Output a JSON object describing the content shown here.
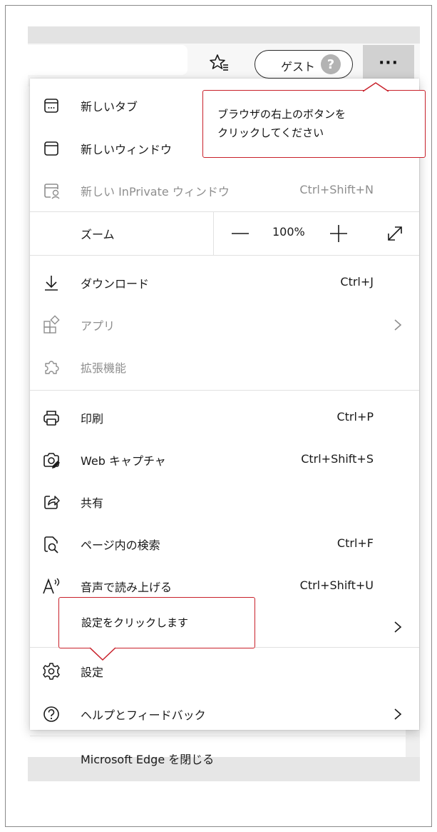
{
  "toolbar": {
    "guest_label": "ゲスト",
    "guest_avatar_glyph": "?",
    "more_label": "···"
  },
  "menu": {
    "new_tab": "新しいタブ",
    "new_window": "新しいウィンドウ",
    "new_inprivate": "新しい InPrivate ウィンドウ",
    "new_inprivate_shortcut": "Ctrl+Shift+N",
    "zoom_label": "ズーム",
    "zoom_value": "100%",
    "downloads": "ダウンロード",
    "downloads_shortcut": "Ctrl+J",
    "apps": "アプリ",
    "extensions": "拡張機能",
    "print": "印刷",
    "print_shortcut": "Ctrl+P",
    "web_capture": "Web キャプチャ",
    "web_capture_shortcut": "Ctrl+Shift+S",
    "share": "共有",
    "find": "ページ内の検索",
    "find_shortcut": "Ctrl+F",
    "read_aloud": "音声で読み上げる",
    "read_aloud_shortcut": "Ctrl+Shift+U",
    "settings": "設定",
    "help": "ヘルプとフィードバック",
    "close_edge": "Microsoft Edge を閉じる"
  },
  "callouts": {
    "top_line1": "ブラウザの右上のボタンを",
    "top_line2": "クリックしてください",
    "settings": "設定をクリックします"
  },
  "colors": {
    "callout_border": "#c8202a",
    "disabled_text": "#8e8e8e"
  }
}
